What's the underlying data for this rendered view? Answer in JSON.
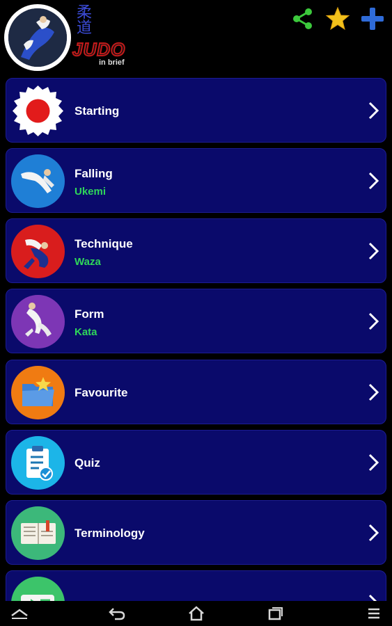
{
  "app": {
    "brand_kanji": [
      "柔",
      "道"
    ],
    "brand_title": "JUDO",
    "brand_subtitle": "in brief",
    "actions": [
      {
        "name": "share-icon",
        "color": "#3cc93c"
      },
      {
        "name": "star-icon",
        "color": "#f3c21b"
      },
      {
        "name": "plus-icon",
        "color": "#2f6bd8"
      }
    ]
  },
  "menu": {
    "items": [
      {
        "title": "Starting",
        "subtitle": "",
        "icon": "rising-sun-icon",
        "icon_bg": "#ffffff"
      },
      {
        "title": "Falling",
        "subtitle": "Ukemi",
        "icon": "falling-judoka-icon",
        "icon_bg": "#1f7fd6"
      },
      {
        "title": "Technique",
        "subtitle": "Waza",
        "icon": "throw-technique-icon",
        "icon_bg": "#d91d1d"
      },
      {
        "title": "Form",
        "subtitle": "Kata",
        "icon": "kata-form-icon",
        "icon_bg": "#7d36b5"
      },
      {
        "title": "Favourite",
        "subtitle": "",
        "icon": "star-folder-icon",
        "icon_bg": "#f07b12"
      },
      {
        "title": "Quiz",
        "subtitle": "",
        "icon": "clipboard-check-icon",
        "icon_bg": "#1cb5e8"
      },
      {
        "title": "Terminology",
        "subtitle": "",
        "icon": "book-icon",
        "icon_bg": "#3cb87a"
      },
      {
        "title": "",
        "subtitle": "",
        "icon": "video-icon",
        "icon_bg": "#3cc46a"
      }
    ]
  },
  "navbar": {
    "buttons": [
      "expand-icon",
      "back-icon",
      "home-icon",
      "recents-icon",
      "menu-icon"
    ]
  }
}
